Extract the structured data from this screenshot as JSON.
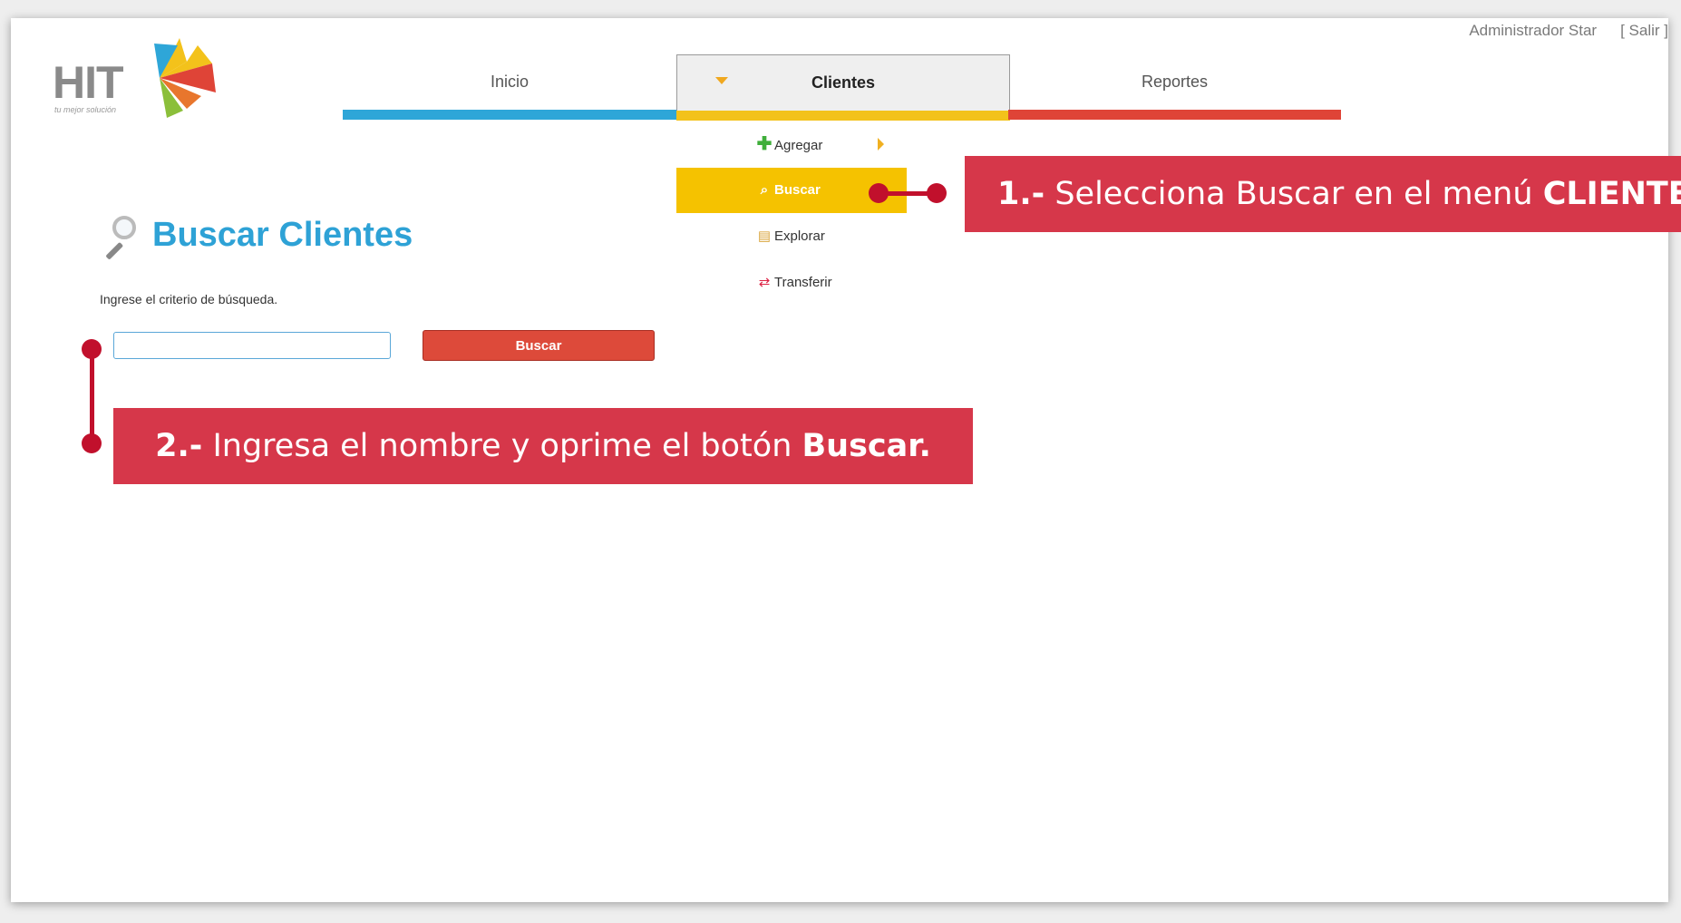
{
  "header": {
    "user_name": "Administrador Star",
    "logout_label": "[ Salir ]",
    "logo_text": "HIT",
    "logo_tagline": "tu mejor solución"
  },
  "nav": {
    "items": [
      {
        "label": "Inicio",
        "color": "#2ea6d8"
      },
      {
        "label": "Clientes",
        "color": "#f3c21b",
        "active": true
      },
      {
        "label": "Reportes",
        "color": "#df4437"
      }
    ]
  },
  "clientes_menu": {
    "items": [
      {
        "label": "Agregar",
        "icon": "plus-icon",
        "has_submenu": true
      },
      {
        "label": "Buscar",
        "icon": "magnifier-icon",
        "selected": true
      },
      {
        "label": "Explorar",
        "icon": "folder-icon"
      },
      {
        "label": "Transferir",
        "icon": "transfer-icon"
      }
    ]
  },
  "page": {
    "title": "Buscar Clientes",
    "instruction": "Ingrese el criterio de búsqueda.",
    "search_value": "",
    "search_button_label": "Buscar"
  },
  "annotations": {
    "step1": {
      "num": "1.-",
      "text": " Selecciona Buscar en el menú ",
      "bold": "CLIENTES."
    },
    "step2": {
      "num": "2.-",
      "text": " Ingresa el nombre y oprime el botón ",
      "bold": "Buscar."
    }
  },
  "colors": {
    "callout": "#d6374a",
    "accent_blue": "#2ea2d6",
    "menu_selected": "#f5c200",
    "button_red": "#dd4a3a"
  }
}
